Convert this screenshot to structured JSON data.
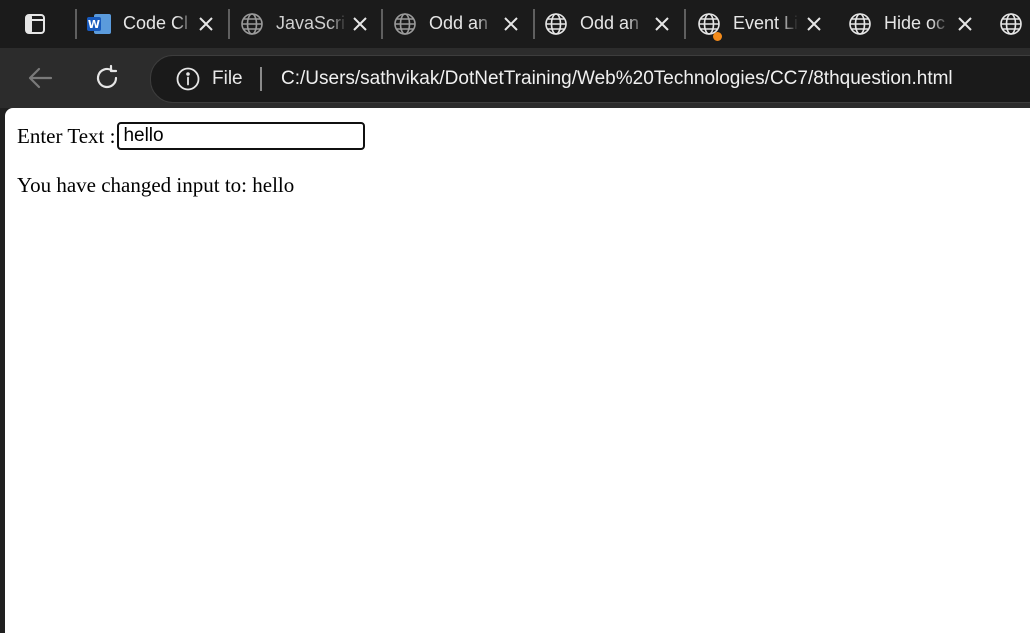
{
  "browser": {
    "tabs": [
      {
        "title": "Code Cl",
        "icon": "word-icon"
      },
      {
        "title": "JavaScri",
        "icon": "globe-icon"
      },
      {
        "title": "Odd an",
        "icon": "globe-icon"
      },
      {
        "title": "Odd an",
        "icon": "globe-icon"
      },
      {
        "title": "Event Li",
        "icon": "globe-icon"
      },
      {
        "title": "Hide oc",
        "icon": "globe-icon"
      },
      {
        "title": "",
        "icon": "globe-icon"
      }
    ],
    "address_bar": {
      "scheme_label": "File",
      "url": "C:/Users/sathvikak/DotNetTraining/Web%20Technologies/CC7/8thquestion.html"
    }
  },
  "page": {
    "input_label": "Enter Text :",
    "input_value": "hello",
    "output_prefix": "You have changed input to: ",
    "output_value": "hello"
  },
  "colors": {
    "tab_strip": "#1b1b1b",
    "toolbar": "#2c2c2c",
    "notification_dot": "#f38b1b",
    "word_blue": "#185abd"
  }
}
